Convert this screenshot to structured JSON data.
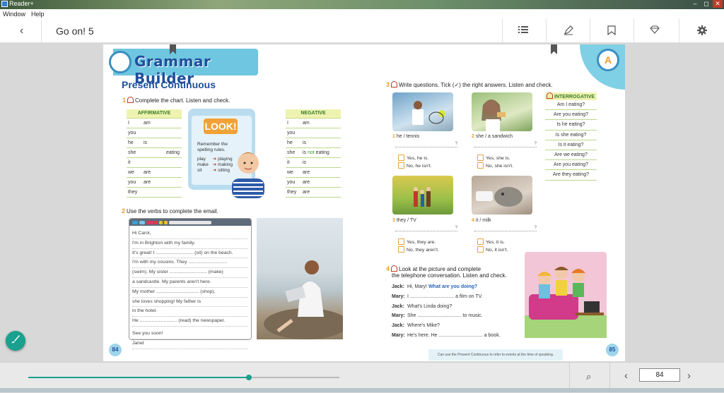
{
  "window": {
    "app_name": "Reader+",
    "minimize": "–",
    "restore": "◻",
    "close": "✕"
  },
  "menu": [
    "Window",
    "Help"
  ],
  "toolbar": {
    "back_glyph": "‹",
    "title": "Go on! 5",
    "icons": [
      "list-icon",
      "highlighter-icon",
      "bookmark-icon",
      "diamond-icon",
      "gear-icon"
    ]
  },
  "book": {
    "banner": "Grammar Builder",
    "heading": "Present Continuous",
    "task1": {
      "num": "1",
      "text": "Complete the chart. Listen and check."
    },
    "affirmative": {
      "header": "AFFIRMATIVE",
      "rows": [
        [
          "I",
          "am",
          ""
        ],
        [
          "you",
          "",
          ""
        ],
        [
          "he",
          "is",
          ""
        ],
        [
          "she",
          "",
          "eating"
        ],
        [
          "it",
          "",
          ""
        ],
        [
          "we",
          "are",
          ""
        ],
        [
          "you",
          "are",
          ""
        ],
        [
          "they",
          "",
          ""
        ]
      ]
    },
    "look": {
      "badge": "LOOK!",
      "rule1": "Remember the",
      "rule2": "spelling rules.",
      "pairs": [
        [
          "play",
          "playing"
        ],
        [
          "make",
          "making"
        ],
        [
          "sit",
          "sitting"
        ]
      ]
    },
    "negative": {
      "header": "NEGATIVE",
      "rows": [
        [
          "I",
          "am"
        ],
        [
          "you",
          ""
        ],
        [
          "he",
          "is"
        ],
        [
          "she",
          "is not eating"
        ],
        [
          "it",
          "is"
        ],
        [
          "we",
          "are"
        ],
        [
          "you",
          "are"
        ],
        [
          "they",
          "are"
        ]
      ]
    },
    "task2": {
      "num": "2",
      "text": "Use the verbs to complete the email."
    },
    "email": [
      "Hi Carol,",
      "I'm in Brighton with my family.",
      "It's great! I ............................ (sit) on the beach.",
      "I'm with my cousins. They .............................",
      "(swim). My sister ............................ (make)",
      "a sandcastle. My parents aren't here.",
      "My mother ................................ (shop),",
      "she loves shopping! My father is",
      "in the hotel.",
      "He ............................ (read) the newspaper.",
      "See you soon!",
      "Janet"
    ],
    "page_left": "84",
    "task3": {
      "num": "3",
      "text": "Write questions. Tick (✓) the right answers. Listen and check."
    },
    "pics": [
      {
        "num": "1",
        "label": "he / tennis",
        "yes": "Yes, he is.",
        "no": "No, he isn't."
      },
      {
        "num": "2",
        "label": "she / a sandwich",
        "yes": "Yes, she is.",
        "no": "No, she isn't."
      },
      {
        "num": "3",
        "label": "they / TV",
        "yes": "Yes, they are.",
        "no": "No, they aren't."
      },
      {
        "num": "4",
        "label": "it / milk",
        "yes": "Yes, it is.",
        "no": "No, it isn't."
      }
    ],
    "qmark": "?",
    "interrogative": {
      "header": "INTERROGATIVE",
      "items": [
        "Am I eating?",
        "Are you eating?",
        "Is he eating?",
        "Is she eating?",
        "Is it eating?",
        "Are we eating?",
        "Are you eating?",
        "Are they eating?"
      ]
    },
    "task4": {
      "num": "4",
      "line1": "Look at the picture and complete",
      "line2": "the telephone conversation. Listen and check."
    },
    "dialog": [
      {
        "who": "Jack:",
        "text": "Hi, Mary! ",
        "q": "What are you doing?"
      },
      {
        "who": "Mary:",
        "text": "I ................................ a film on TV.",
        "q": ""
      },
      {
        "who": "Jack:",
        "text": "What's Linda doing?",
        "q": ""
      },
      {
        "who": "Mary:",
        "text": "She ................................ to music.",
        "q": ""
      },
      {
        "who": "Jack:",
        "text": "Where's Mike?",
        "q": ""
      },
      {
        "who": "Mary:",
        "text": "He's here. He ................................ a book.",
        "q": ""
      }
    ],
    "caption": "Can use the Present Continuous to refer to events at the time of speaking.",
    "page_right": "85"
  },
  "bottom": {
    "progress": 0.71,
    "page_input": "84",
    "zoom_icon": "⌕",
    "prev": "‹",
    "next": "›"
  },
  "fab_icon": "brush-icon",
  "colors": {
    "accent": "#1aa08f",
    "heading": "#1e4f9c",
    "task_num": "#f29b2a"
  }
}
